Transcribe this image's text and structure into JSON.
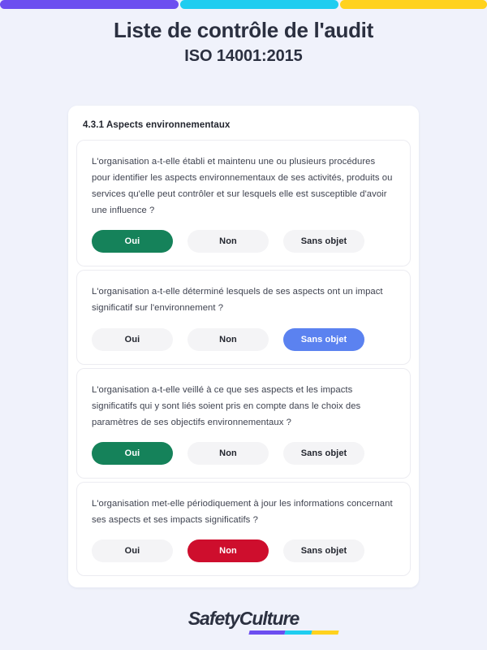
{
  "brand": {
    "purple": "#6c4ef0",
    "cyan": "#1fcdf0",
    "yellow": "#ffd21e",
    "green": "#15825a",
    "red": "#ce0e2d",
    "blue": "#5b82f0",
    "page_bg": "#f0f2fb",
    "text_dark": "#2b3040"
  },
  "header": {
    "title": "Liste de contrôle de l'audit",
    "subtitle": "ISO 14001:2015"
  },
  "section": {
    "heading": "4.3.1 Aspects environnementaux"
  },
  "answer_labels": {
    "yes": "Oui",
    "no": "Non",
    "na": "Sans objet"
  },
  "questions": [
    {
      "text": "L'organisation a-t-elle établi et maintenu une ou plusieurs procédures pour identifier les aspects environnementaux de ses activités, produits ou services qu'elle peut contrôler et sur lesquels elle est susceptible d'avoir une influence ?",
      "selected": "yes"
    },
    {
      "text": "L'organisation a-t-elle déterminé lesquels de ses aspects ont un impact significatif sur l'environnement ?",
      "selected": "na"
    },
    {
      "text": "L'organisation a-t-elle veillé à ce que ses aspects et les impacts significatifs qui y sont liés soient pris en compte dans le choix des paramètres de ses objectifs environnementaux ?",
      "selected": "yes"
    },
    {
      "text": "L'organisation met-elle périodiquement à jour les informations concernant ses aspects et ses impacts significatifs ?",
      "selected": "no"
    }
  ],
  "footer": {
    "logo_text": "SafetyCulture"
  }
}
